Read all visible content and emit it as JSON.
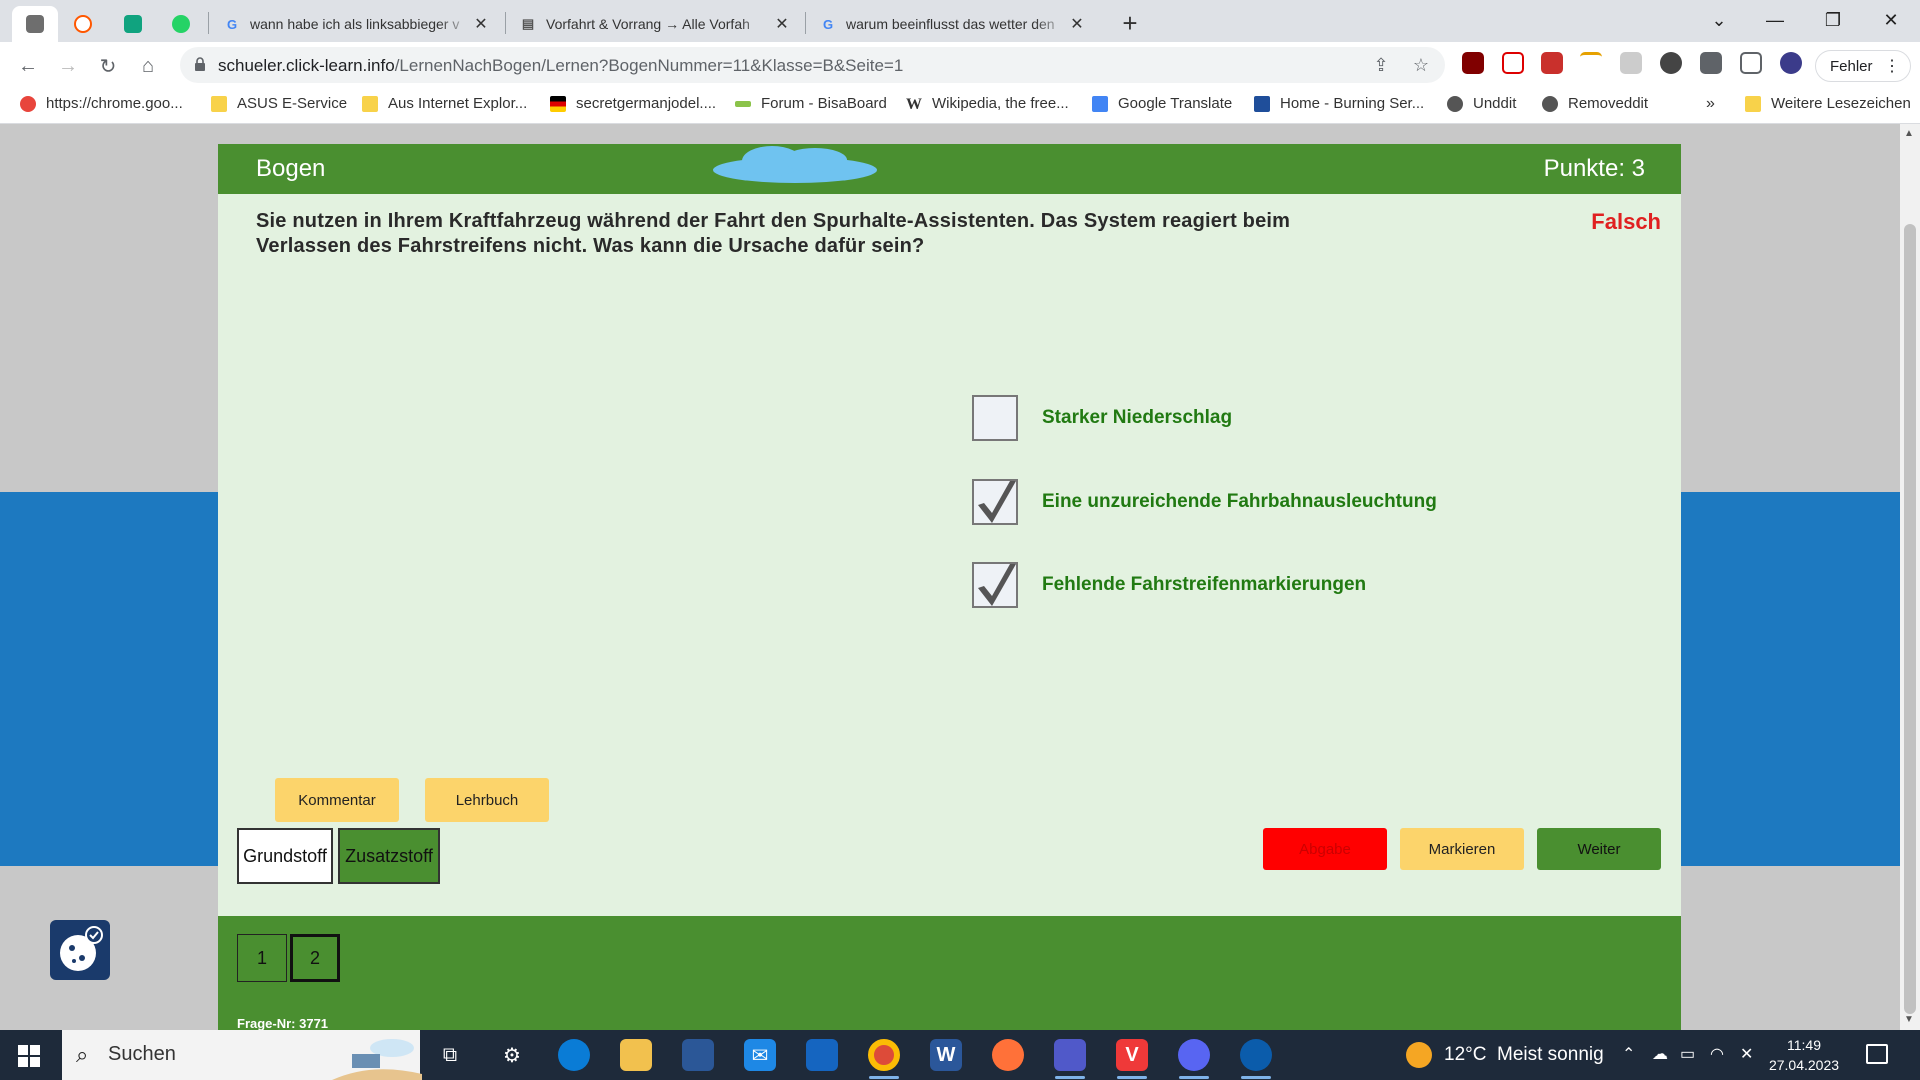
{
  "browser": {
    "tabs": [
      {
        "title": "wann habe ich als linksabbieger v",
        "favicon": "google-icon"
      },
      {
        "title": "Vorfahrt & Vorrang → Alle Vorfah",
        "favicon": "news-icon"
      },
      {
        "title": "warum beeinflusst das wetter den",
        "favicon": "google-icon"
      }
    ],
    "url_host": "schueler.click-learn.info",
    "url_path": "/LernenNachBogen/Lernen?BogenNummer=11&Klasse=B&Seite=1",
    "profile_button": "Fehler",
    "bookmarks": [
      "https://chrome.goo...",
      "ASUS E-Service",
      "Aus Internet Explor...",
      "secretgermanjodel....",
      "Forum - BisaBoard",
      "Wikipedia, the free...",
      "Google Translate",
      "Home - Burning Ser...",
      "Unddit",
      "Removeddit"
    ],
    "more_bookmarks": "»",
    "other_bookmarks": "Weitere Lesezeichen"
  },
  "quiz": {
    "header_title": "Bogen",
    "points": "Punkte: 3",
    "question": "Sie nutzen in Ihrem Kraftfahrzeug während der Fahrt den Spurhalte-Assistenten. Das System reagiert beim Verlassen des Fahrstreifens nicht. Was kann die Ursache dafür sein?",
    "verdict": "Falsch",
    "answers": [
      {
        "label": "Starker Niederschlag",
        "checked": false
      },
      {
        "label": "Eine unzureichende Fahrbahnausleuchtung",
        "checked": true
      },
      {
        "label": "Fehlende Fahrstreifenmarkierungen",
        "checked": true
      }
    ],
    "comment_button": "Kommentar",
    "textbook_button": "Lehrbuch",
    "basic_tab": "Grundstoff",
    "extra_tab": "Zusatzstoff",
    "submit_button": "Abgabe",
    "mark_button": "Markieren",
    "next_button": "Weiter",
    "pages": [
      "1",
      "2"
    ],
    "question_number": "Frage-Nr: 3771"
  },
  "taskbar": {
    "search_placeholder": "Suchen",
    "weather": "12°C  Meist sonnig",
    "time": "11:49",
    "date": "27.04.2023"
  },
  "colors": {
    "header_green": "#4a8f30",
    "card_bg": "#e3f2e0",
    "answer_text": "#217a12",
    "verdict_red": "#e02020",
    "submit_red": "#ff0000",
    "yellow": "#fcd46b",
    "band_blue": "#1d79c0"
  }
}
